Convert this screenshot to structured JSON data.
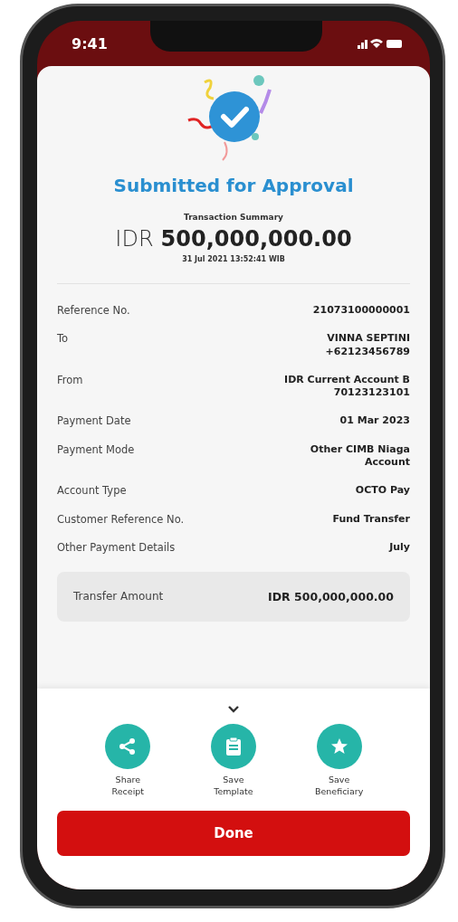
{
  "status_bar": {
    "time": "9:41"
  },
  "result": {
    "title": "Submitted for Approval",
    "subtitle": "Transaction Summary",
    "currency": "IDR",
    "amount": "500,000,000.00",
    "timestamp": "31 Jul 2021 13:52:41 WIB"
  },
  "details": [
    {
      "label": "Reference No.",
      "value": "21073100000001"
    },
    {
      "label": "To",
      "value": "VINNA SEPTINI\n+62123456789"
    },
    {
      "label": "From",
      "value": "IDR Current Account B\n70123123101"
    },
    {
      "label": "Payment Date",
      "value": "01 Mar 2023"
    },
    {
      "label": "Payment Mode",
      "value": "Other CIMB Niaga\nAccount"
    },
    {
      "label": "Account Type",
      "value": "OCTO Pay"
    },
    {
      "label": "Customer Reference No.",
      "value": "Fund Transfer"
    },
    {
      "label": "Other Payment Details",
      "value": "July"
    }
  ],
  "total": {
    "label": "Transfer Amount",
    "value": "IDR 500,000,000.00"
  },
  "actions": [
    {
      "kind": "share",
      "label": "Share\nReceipt"
    },
    {
      "kind": "template",
      "label": "Save\nTemplate"
    },
    {
      "kind": "star",
      "label": "Save\nBeneficiary"
    }
  ],
  "done_button": "Done"
}
